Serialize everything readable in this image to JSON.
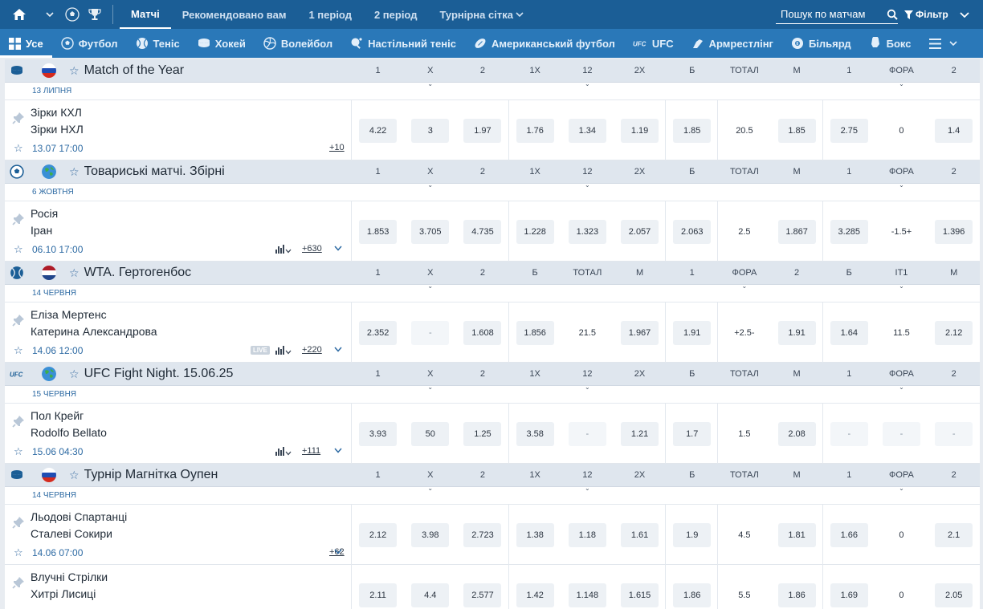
{
  "topnav": {
    "tabs": [
      "Матчі",
      "Рекомендовано вам",
      "1 період",
      "2 період",
      "Турнірна сітка"
    ],
    "search_placeholder": "Пошук по матчам",
    "filter_label": "Фільтр"
  },
  "sports": [
    "Усе",
    "Футбол",
    "Теніс",
    "Хокей",
    "Волейбол",
    "Настільний теніс",
    "Американський футбол",
    "UFC",
    "Армрестлінг",
    "Більярд",
    "Бокс"
  ],
  "leagues": [
    {
      "sport": "hockey",
      "flag": "ru",
      "name": "Match of the Year",
      "date": "13 липня",
      "headers": [
        "1",
        "X",
        "2",
        "1X",
        "12",
        "2X",
        "Б",
        "ТОТАЛ",
        "М",
        "1",
        "ФОРА",
        "2"
      ],
      "events": [
        {
          "team1": "Зірки КХЛ",
          "team2": "Зірки НХЛ",
          "datetime": "13.07 17:00",
          "more": "+10",
          "live": false,
          "stats": false,
          "odds": [
            "4.22",
            "3",
            "1.97",
            "1.76",
            "1.34",
            "1.19",
            "1.85",
            "20.5",
            "1.85",
            "2.75",
            "0",
            "1.4"
          ]
        }
      ]
    },
    {
      "sport": "football",
      "flag": "world",
      "name": "Товариські матчі. Збірні",
      "date": "6 жовтня",
      "headers": [
        "1",
        "X",
        "2",
        "1X",
        "12",
        "2X",
        "Б",
        "ТОТАЛ",
        "М",
        "1",
        "ФОРА",
        "2"
      ],
      "events": [
        {
          "team1": "Росія",
          "team2": "Іран",
          "datetime": "06.10 17:00",
          "more": "+630",
          "live": false,
          "stats": true,
          "odds": [
            "1.853",
            "3.705",
            "4.735",
            "1.228",
            "1.323",
            "2.057",
            "2.063",
            "2.5",
            "1.867",
            "3.285",
            "-1.5+",
            "1.396"
          ]
        }
      ]
    },
    {
      "sport": "tennis",
      "flag": "nl",
      "name": "WTA. Гертогенбос",
      "date": "14 червня",
      "headers": [
        "1",
        "X",
        "2",
        "Б",
        "ТОТАЛ",
        "М",
        "1",
        "ФОРА",
        "2",
        "Б",
        "IT1",
        "М"
      ],
      "events": [
        {
          "team1": "Еліза Мертенс",
          "team2": "Катерина Александрова",
          "datetime": "14.06 12:00",
          "more": "+220",
          "live": true,
          "live_label": "LIVE",
          "stats": true,
          "odds": [
            "2.352",
            "-",
            "1.608",
            "1.856",
            "21.5",
            "1.967",
            "1.91",
            "+2.5-",
            "1.91",
            "1.64",
            "11.5",
            "2.12"
          ]
        }
      ]
    },
    {
      "sport": "ufc",
      "flag": "world",
      "name": "UFC Fight Night. 15.06.25",
      "date": "15 червня",
      "headers": [
        "1",
        "X",
        "2",
        "1X",
        "12",
        "2X",
        "Б",
        "ТОТАЛ",
        "М",
        "1",
        "ФОРА",
        "2"
      ],
      "events": [
        {
          "team1": "Пол Крейг",
          "team2": "Rodolfo Bellato",
          "datetime": "15.06 04:30",
          "more": "+111",
          "live": false,
          "stats": true,
          "odds": [
            "3.93",
            "50",
            "1.25",
            "3.58",
            "-",
            "1.21",
            "1.7",
            "1.5",
            "2.08",
            "-",
            "-",
            "-"
          ]
        }
      ]
    },
    {
      "sport": "hockey",
      "flag": "ru",
      "name": "Турнір Магнітка Оупен",
      "date": "14 червня",
      "headers": [
        "1",
        "X",
        "2",
        "1X",
        "12",
        "2X",
        "Б",
        "ТОТАЛ",
        "М",
        "1",
        "ФОРА",
        "2"
      ],
      "events": [
        {
          "team1": "Льодові Спартанці",
          "team2": "Сталеві Сокири",
          "datetime": "14.06 07:00",
          "more": "+62",
          "live": false,
          "stats": false,
          "odds": [
            "2.12",
            "3.98",
            "2.723",
            "1.38",
            "1.18",
            "1.61",
            "1.9",
            "4.5",
            "1.81",
            "1.66",
            "0",
            "2.1"
          ]
        },
        {
          "team1": "Влучні Стрілки",
          "team2": "Хитрі Лисиці",
          "datetime": "",
          "more": "",
          "live": false,
          "stats": false,
          "odds": [
            "2.11",
            "4.4",
            "2.577",
            "1.42",
            "1.148",
            "1.615",
            "1.86",
            "5.5",
            "1.86",
            "1.69",
            "0",
            "2.05"
          ]
        }
      ]
    }
  ],
  "colors": {
    "topbar": "#1b5e96",
    "sportbar": "#2a78b8",
    "accent": "#2d6aa3"
  }
}
